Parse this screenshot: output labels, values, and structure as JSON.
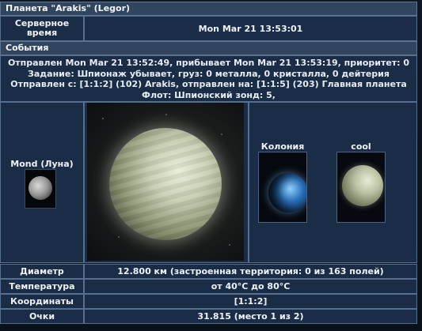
{
  "title": "Планета \"Arakis\" (Legor)",
  "server_time": {
    "label": "Серверное время",
    "value": "Mon Mar 21 13:53:01"
  },
  "events": {
    "header": "События",
    "lines": [
      "Отправлен Mon Mar 21 13:52:49, прибывает Mon Mar 21 13:53:19, приоритет: 0",
      "Задание: Шпионаж убывает, груз: 0 металла, 0 кристалла, 0 дейтерия",
      "Отправлен с: [1:1:2] (102) Arakis, отправлен на: [1:1:5] (203) Главная планета",
      "Флот: Шпионский зонд: 5,"
    ]
  },
  "moon": {
    "label": "Mond (Луна)"
  },
  "thumbs": [
    {
      "label": "Колония"
    },
    {
      "label": "cool"
    }
  ],
  "stats": [
    {
      "label": "Диаметр",
      "value": "12.800 км (застроенная территория: 0 из 163 полей)"
    },
    {
      "label": "Температура",
      "value": "от 40°C до 80°C"
    },
    {
      "label": "Координаты",
      "value": "[1:1:2]"
    },
    {
      "label": "Очки",
      "value": "31.815 (место 1 из 2)"
    }
  ]
}
